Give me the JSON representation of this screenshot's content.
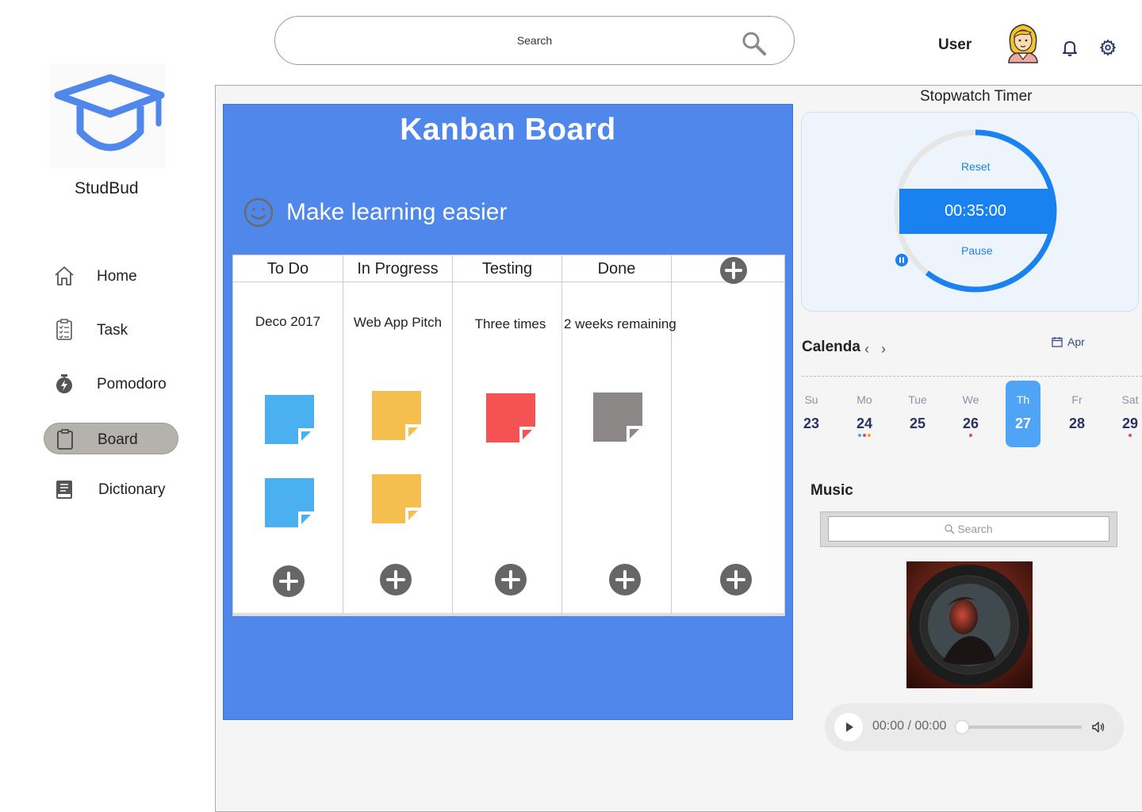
{
  "header": {
    "search_placeholder": "Search",
    "user_label": "User"
  },
  "sidebar": {
    "brand": "StudBud",
    "items": [
      {
        "label": "Home"
      },
      {
        "label": "Task"
      },
      {
        "label": "Pomodoro"
      },
      {
        "label": "Board"
      },
      {
        "label": "Dictionary"
      }
    ],
    "active_item": "Board"
  },
  "kanban": {
    "title": "Kanban Board",
    "tagline": "Make learning easier",
    "columns": [
      {
        "header": "To Do",
        "card": "Deco 2017"
      },
      {
        "header": "In Progress",
        "card": "Web App Pitch"
      },
      {
        "header": "Testing",
        "card": "Three times"
      },
      {
        "header": "Done",
        "card": "2 weeks remaining"
      }
    ],
    "note_colors": {
      "todo": "#4ab0f0",
      "in_progress": "#f4bf4f",
      "testing": "#f55353",
      "done": "#8c8888"
    }
  },
  "stopwatch": {
    "title": "Stopwatch Timer",
    "reset_label": "Reset",
    "time": "00:35:00",
    "pause_label": "Pause",
    "accent": "#1a82f0"
  },
  "calendar": {
    "title": "Calenda",
    "prev": "‹",
    "next": "›",
    "month": "Apr",
    "days": [
      {
        "name": "Su",
        "date": "23"
      },
      {
        "name": "Mo",
        "date": "24"
      },
      {
        "name": "Tue",
        "date": "25"
      },
      {
        "name": "We",
        "date": "26"
      },
      {
        "name": "Th",
        "date": "27"
      },
      {
        "name": "Fr",
        "date": "28"
      },
      {
        "name": "Sat",
        "date": "29"
      }
    ],
    "selected": "27"
  },
  "music": {
    "title": "Music",
    "search_placeholder": "Search",
    "time": "00:00 / 00:00"
  }
}
